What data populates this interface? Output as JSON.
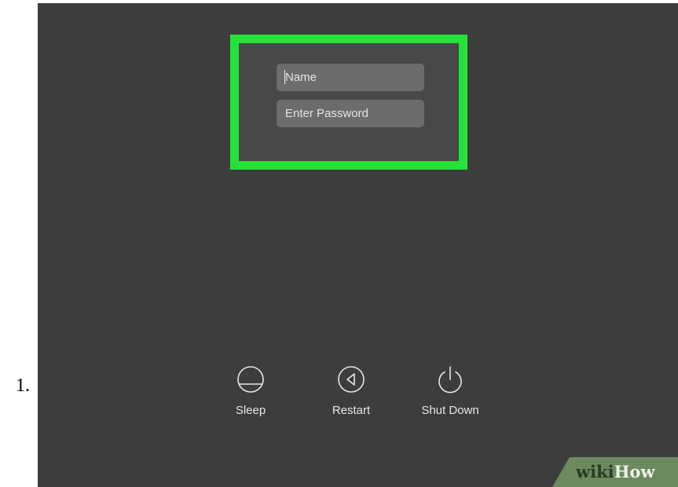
{
  "list_marker": "1.",
  "login": {
    "name_placeholder": "Name",
    "password_placeholder": "Enter Password",
    "highlight_color": "#25e23a"
  },
  "power_options": {
    "sleep": {
      "label": "Sleep",
      "icon": "sleep-icon"
    },
    "restart": {
      "label": "Restart",
      "icon": "restart-icon"
    },
    "shutdown": {
      "label": "Shut Down",
      "icon": "power-icon"
    }
  },
  "watermark": {
    "part1": "wiki",
    "part2": "How"
  }
}
